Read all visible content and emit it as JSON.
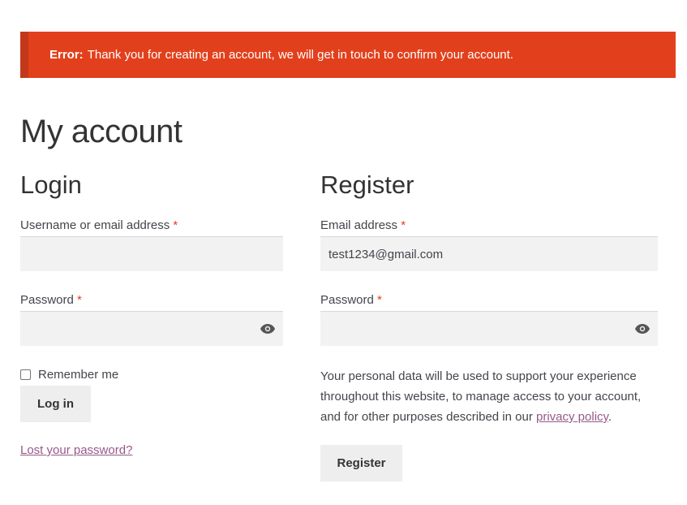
{
  "notice": {
    "prefix": "Error:",
    "message": "Thank you for creating an account, we will get in touch to confirm your account.",
    "color": "#e2401c"
  },
  "page_title": "My account",
  "login": {
    "title": "Login",
    "username_label": "Username or email address",
    "username_value": "",
    "password_label": "Password",
    "password_value": "",
    "required_mark": "*",
    "remember_label": "Remember me",
    "remember_checked": false,
    "login_button": "Log in",
    "lost_password": "Lost your password?"
  },
  "register": {
    "title": "Register",
    "email_label": "Email address",
    "email_value": "test1234@gmail.com",
    "password_label": "Password",
    "password_value": "",
    "required_mark": "*",
    "privacy_text_before": "Your personal data will be used to support your experience throughout this website, to manage access to your account, and for other purposes described in our ",
    "privacy_link": "privacy policy",
    "privacy_text_after": ".",
    "register_button": "Register"
  },
  "icons": {
    "password_toggle": "eye-icon"
  },
  "colors": {
    "link": "#96588a",
    "required": "#e2401c",
    "input_bg": "#f2f2f2",
    "button_bg": "#eeeeee"
  }
}
